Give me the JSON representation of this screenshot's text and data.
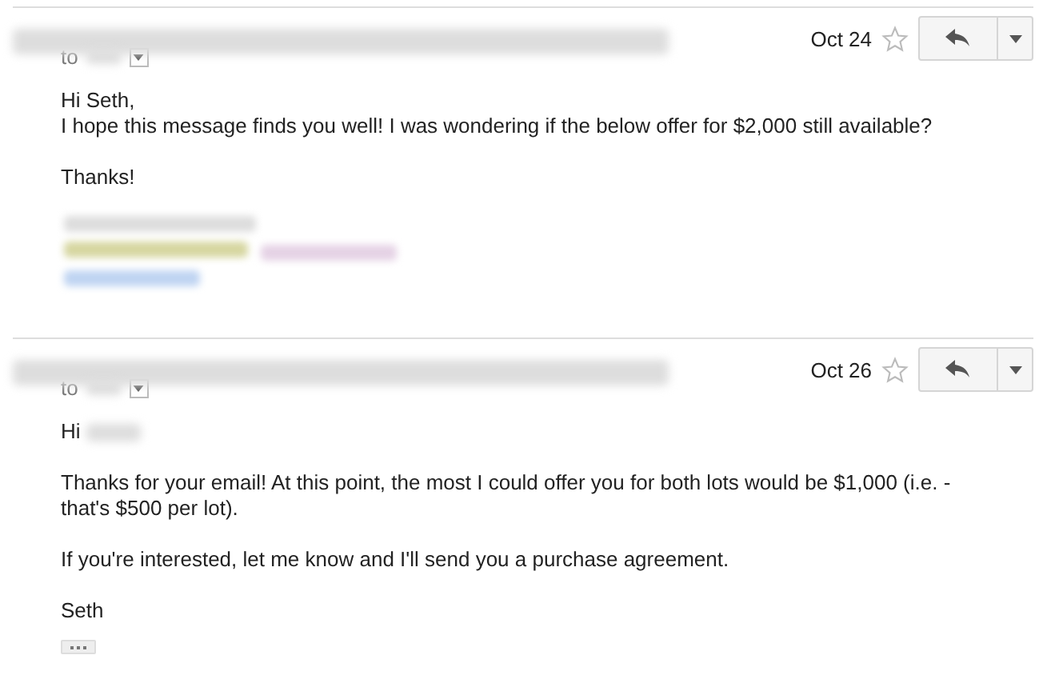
{
  "messages": [
    {
      "date": "Oct 24",
      "starred": false,
      "to_label": "to",
      "greeting": "Hi Seth,",
      "greeting_name_blurred": false,
      "greeting_joined": true,
      "paragraphs": [
        "I hope this message finds you well! I was wondering if the below offer for $2,000 still available?",
        "Thanks!"
      ],
      "signature_blurred": true,
      "trimmed": false
    },
    {
      "date": "Oct 26",
      "starred": false,
      "to_label": "to",
      "greeting": "Hi",
      "greeting_name_blurred": true,
      "greeting_joined": false,
      "paragraphs": [
        "Thanks for your email! At this point, the most I could offer you for both lots would be $1,000 (i.e. - that's $500 per lot).",
        "If you're interested, let me know and I'll send you a purchase agreement."
      ],
      "signature": "Seth",
      "signature_blurred": false,
      "trimmed": true
    }
  ]
}
